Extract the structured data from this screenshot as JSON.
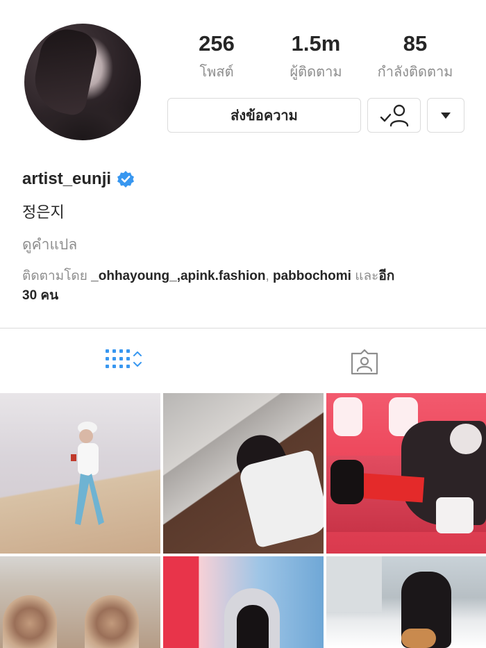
{
  "profile": {
    "stats": [
      {
        "value": "256",
        "label": "โพสต์"
      },
      {
        "value": "1.5m",
        "label": "ผู้ติดตาม"
      },
      {
        "value": "85",
        "label": "กำลังติดตาม"
      }
    ],
    "message_button": "ส่งข้อความ",
    "username": "artist_eunji",
    "full_name": "정은지",
    "translate_link": "ดูคำแปล",
    "followed_by": {
      "prefix": "ติดตามโดย",
      "accounts": [
        "_ohhayoung_",
        "apink.fashion",
        "pabbochomi"
      ],
      "sep1": ",",
      "sep2": ", ",
      "and": "และ",
      "more": "อีก",
      "more_count": "30 คน"
    }
  },
  "icons": {
    "follow": "following-check-person-icon",
    "more": "dropdown-triangle-icon",
    "verified": "verified-badge-icon",
    "grid_tab": "grid-view-icon",
    "tagged_tab": "tagged-photos-icon"
  },
  "colors": {
    "accent": "#3897f0",
    "text_primary": "#262626",
    "text_secondary": "#8e8e8e",
    "border": "#dbdbdb"
  }
}
